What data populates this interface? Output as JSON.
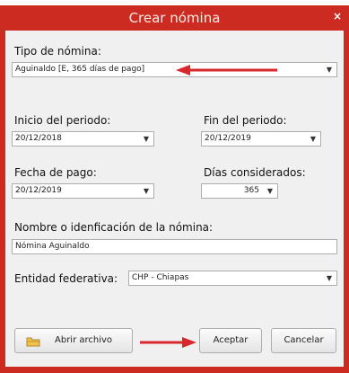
{
  "window": {
    "title": "Crear nómina",
    "close": "×"
  },
  "tipo": {
    "label": "Tipo de nómina:",
    "value": "Aguinaldo [E, 365 días de pago]"
  },
  "inicio": {
    "label": "Inicio del periodo:",
    "value": "20/12/2018"
  },
  "fin": {
    "label": "Fin del periodo:",
    "value": "20/12/2019"
  },
  "pago": {
    "label": "Fecha de pago:",
    "value": "20/12/2019"
  },
  "dias": {
    "label": "Días considerados:",
    "value": "365"
  },
  "nombre": {
    "label": "Nombre o idenficación de la nómina:",
    "value": "Nómina Aguinaldo"
  },
  "entidad": {
    "label": "Entidad federativa:",
    "value": "CHP - Chiapas"
  },
  "buttons": {
    "abrir": "Abrir archivo",
    "aceptar": "Aceptar",
    "cancelar": "Cancelar"
  },
  "colors": {
    "title_bar": "#cc2b22",
    "annotation_arrow": "#d9272e",
    "client_bg": "#f0f0f0"
  },
  "icons": {
    "dropdown": "▼",
    "folder": "folder-icon"
  }
}
